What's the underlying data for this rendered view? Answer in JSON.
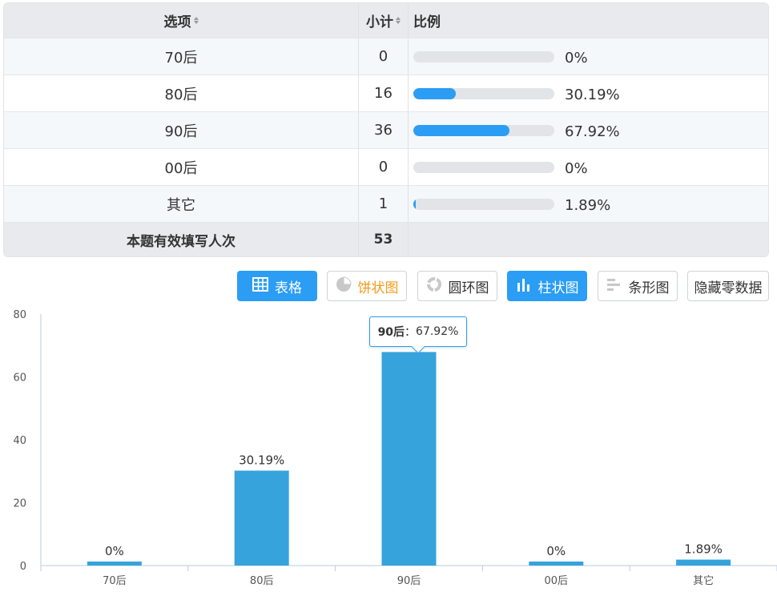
{
  "table": {
    "headers": {
      "option": "选项",
      "count": "小计",
      "ratio": "比例"
    },
    "rows": [
      {
        "option": "70后",
        "count": "0",
        "ratio": "0%",
        "fill": 0
      },
      {
        "option": "80后",
        "count": "16",
        "ratio": "30.19%",
        "fill": 30.19
      },
      {
        "option": "90后",
        "count": "36",
        "ratio": "67.92%",
        "fill": 67.92
      },
      {
        "option": "00后",
        "count": "0",
        "ratio": "0%",
        "fill": 0
      },
      {
        "option": "其它",
        "count": "1",
        "ratio": "1.89%",
        "fill": 1.89
      }
    ],
    "total": {
      "label": "本题有效填写人次",
      "count": "53"
    }
  },
  "buttons": {
    "table": "表格",
    "pie": "饼状图",
    "ring": "圆环图",
    "column": "柱状图",
    "bar": "条形图",
    "hide_zero": "隐藏零数据"
  },
  "tooltip": {
    "label": "90后",
    "sep": "：",
    "value": "67.92%"
  },
  "colors": {
    "accent": "#2b9df4",
    "bar": "#36a3dc",
    "pie_icon": "#f39a1c"
  },
  "chart_data": {
    "type": "bar",
    "categories": [
      "70后",
      "80后",
      "90后",
      "00后",
      "其它"
    ],
    "values": [
      0,
      30.19,
      67.92,
      0,
      1.89
    ],
    "data_labels": [
      "0%",
      "30.19%",
      "67.92%",
      "0%",
      "1.89%"
    ],
    "y_ticks": [
      "0",
      "20",
      "40",
      "60",
      "80"
    ],
    "ylim": [
      0,
      80
    ],
    "grid": false
  }
}
